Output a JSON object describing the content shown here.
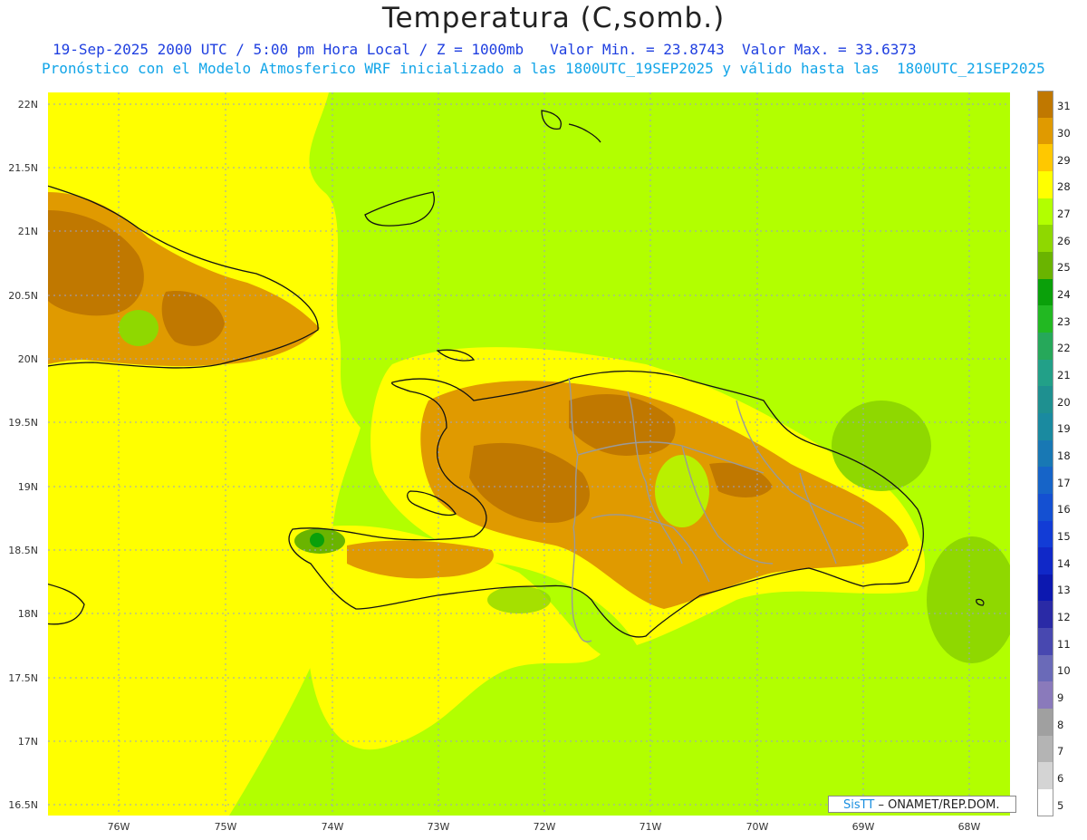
{
  "title": "Temperatura (C,somb.)",
  "subtitle_line1": "19-Sep-2025 2000 UTC / 5:00 pm Hora Local / Z = 1000mb   Valor Min. = 23.8743  Valor Max. = 33.6373",
  "subtitle_line2": "Pronóstico con el Modelo Atmosferico WRF inicializado a las 1800UTC_19SEP2025 y válido hasta las  1800UTC_21SEP2025",
  "lat_labels": [
    "22N",
    "21.5N",
    "21N",
    "20.5N",
    "20N",
    "19.5N",
    "19N",
    "18.5N",
    "18N",
    "17.5N",
    "17N",
    "16.5N"
  ],
  "lon_labels": [
    "76W",
    "75W",
    "74W",
    "73W",
    "72W",
    "71W",
    "70W",
    "69W",
    "68W"
  ],
  "colorbar": {
    "levels": [
      "31",
      "30",
      "29",
      "28",
      "27",
      "26",
      "25",
      "24",
      "23",
      "22",
      "21",
      "20",
      "19",
      "18",
      "17",
      "16",
      "15",
      "14",
      "13",
      "12",
      "11",
      "10",
      "9",
      "8",
      "7",
      "6",
      "5"
    ],
    "colors": [
      "#c07800",
      "#e09a00",
      "#ffc800",
      "#ffff00",
      "#b2ff00",
      "#8fd800",
      "#6ab400",
      "#0aa00a",
      "#22b822",
      "#26a85a",
      "#22a088",
      "#1e9090",
      "#1a8aa0",
      "#1878b4",
      "#1664c8",
      "#1450d2",
      "#123cd6",
      "#1028c8",
      "#0c18b0",
      "#2a2aa6",
      "#4848b0",
      "#6a6ab8",
      "#8a7abb",
      "#a0a0a0",
      "#b4b4b4",
      "#d4d4d4",
      "#ffffff"
    ]
  },
  "credit": {
    "logo": "SisTT",
    "text": "– ONAMET/REP.DOM."
  },
  "colors": {
    "sea": "#b2ff00",
    "warm": "#ffff00",
    "hot": "#e09a00",
    "very_hot": "#c07800",
    "cool": "#8fd800"
  }
}
